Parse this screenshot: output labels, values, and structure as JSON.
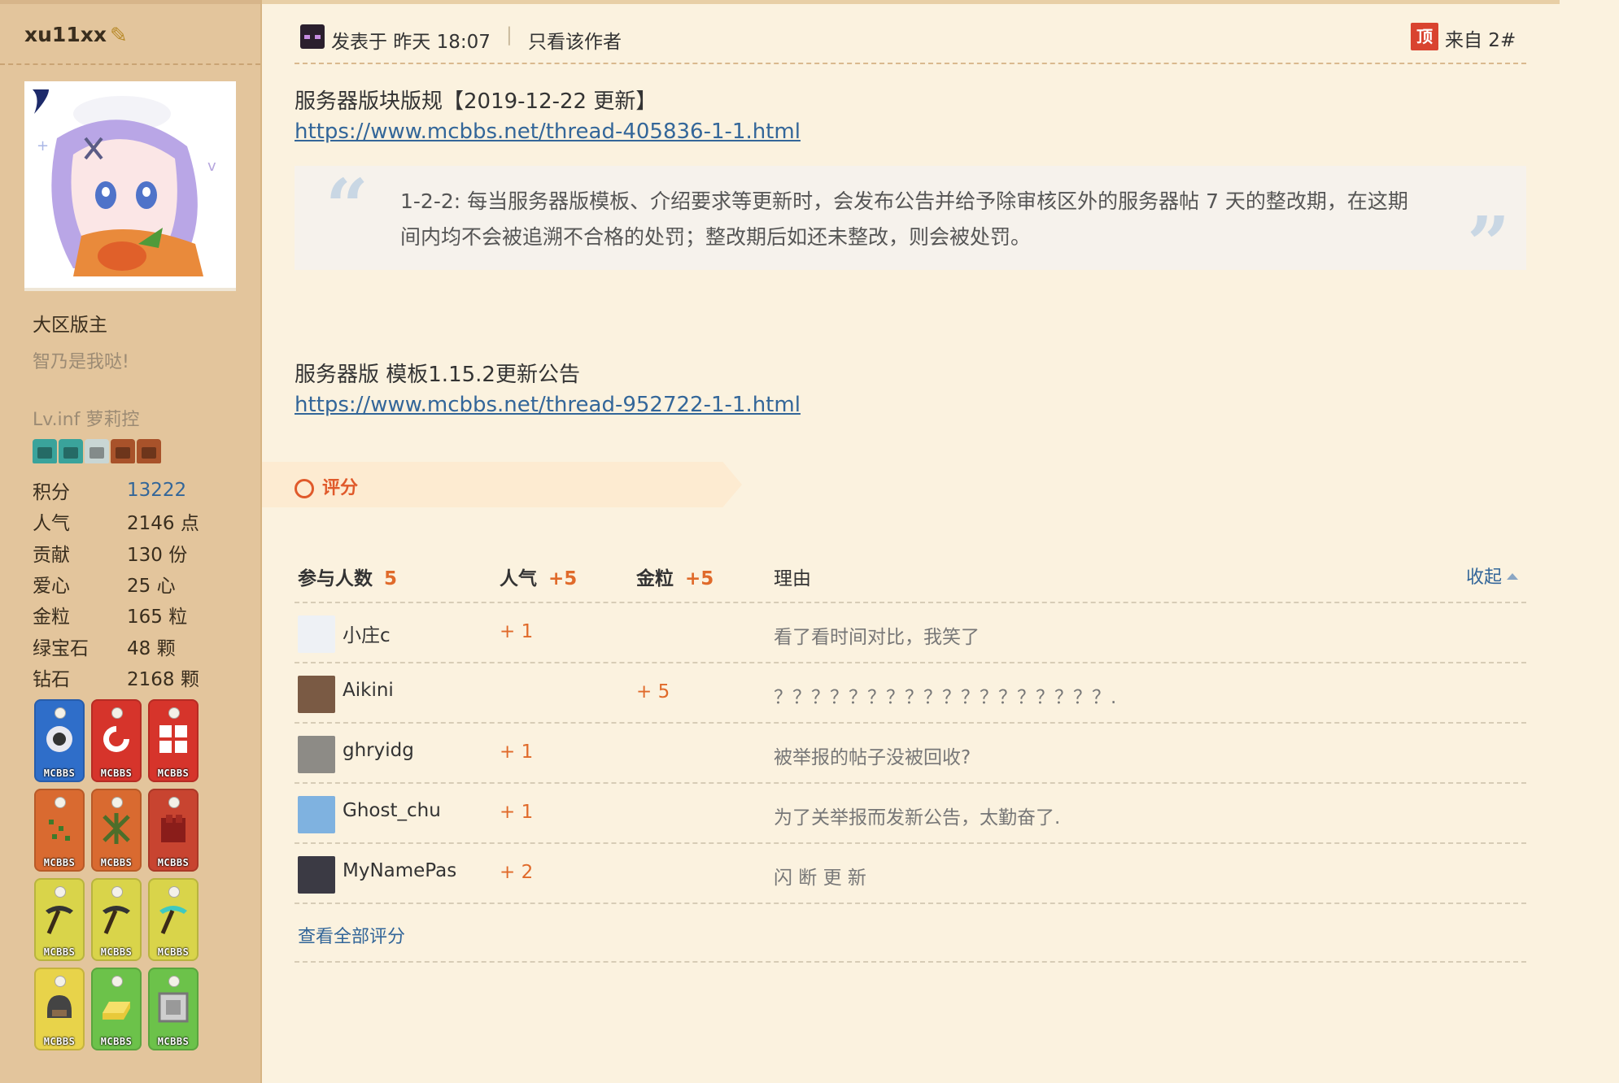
{
  "sidebar": {
    "username": "xu11xx",
    "role": "大区版主",
    "custom_title": "智乃是我哒!",
    "level": "Lv.inf 萝莉控",
    "level_colors": [
      "#3aa39b",
      "#3aa39b",
      "#c9d6d4",
      "#a8522a",
      "#a8522a"
    ],
    "stats": [
      {
        "key": "积分",
        "value": "13222",
        "link": true
      },
      {
        "key": "人气",
        "value": "2146 点",
        "link": false
      },
      {
        "key": "贡献",
        "value": "130 份",
        "link": false
      },
      {
        "key": "爱心",
        "value": "25 心",
        "link": false
      },
      {
        "key": "金粒",
        "value": "165 粒",
        "link": false
      },
      {
        "key": "绿宝石",
        "value": "48 颗",
        "link": false
      },
      {
        "key": "钻石",
        "value": "2168 颗",
        "link": false
      }
    ],
    "medals": [
      {
        "color": "#2f6ec9",
        "icon": "eye-icon",
        "tag": "MCBBS"
      },
      {
        "color": "#d6342b",
        "icon": "swirl-icon",
        "tag": "MCBBS"
      },
      {
        "color": "#d6342b",
        "icon": "window-icon",
        "tag": "MCBBS"
      },
      {
        "color": "#d96a30",
        "icon": "seeds-icon",
        "tag": "MCBBS"
      },
      {
        "color": "#d96a30",
        "icon": "vine-icon",
        "tag": "MCBBS"
      },
      {
        "color": "#c84430",
        "icon": "netherwart-icon",
        "tag": "MCBBS"
      },
      {
        "color": "#d9d44a",
        "icon": "pickaxe-icon",
        "tag": "MCBBS"
      },
      {
        "color": "#d9d44a",
        "icon": "pickaxe-icon",
        "tag": "MCBBS"
      },
      {
        "color": "#d9d44a",
        "icon": "diamond-pickaxe-icon",
        "tag": "MCBBS"
      },
      {
        "color": "#e8d34a",
        "icon": "helmet-icon",
        "tag": "MCBBS"
      },
      {
        "color": "#6cc24a",
        "icon": "gold-ingot-icon",
        "tag": "MCBBS"
      },
      {
        "color": "#6cc24a",
        "icon": "frame-icon",
        "tag": "MCBBS"
      }
    ]
  },
  "post": {
    "posted_at": "发表于 昨天 18:07",
    "separator": "|",
    "only_author": "只看该作者",
    "top_badge": "顶",
    "floor": "来自 2#",
    "line1": "服务器版块版规【2019-12-22 更新】",
    "link1": "https://www.mcbbs.net/thread-405836-1-1.html",
    "quote": "1-2-2: 每当服务器版模板、介绍要求等更新时，会发布公告并给予除审核区外的服务器帖 7 天的整改期，在这期间内均不会被追溯不合格的处罚；整改期后如还未整改，则会被处罚。",
    "line2": "服务器版 模板1.15.2更新公告",
    "link2": "https://www.mcbbs.net/thread-952722-1-1.html"
  },
  "rating": {
    "tab_label": "评分",
    "headers": {
      "participants": "参与人数",
      "participants_count": "5",
      "popularity": "人气",
      "popularity_total": "+5",
      "gold": "金粒",
      "gold_total": "+5",
      "reason": "理由",
      "collapse": "收起"
    },
    "rows": [
      {
        "name": "小庄c",
        "popularity": "+ 1",
        "gold": "",
        "reason": "看了看时间对比，我笑了",
        "avatar_color": "#eef1f5"
      },
      {
        "name": "Aikini",
        "popularity": "",
        "gold": "+ 5",
        "reason": "？？？？？？？？？？？？？？？？？？.",
        "avatar_color": "#7a5a44"
      },
      {
        "name": "ghryidg",
        "popularity": "+ 1",
        "gold": "",
        "reason": "被举报的帖子没被回收?",
        "avatar_color": "#8d8b86"
      },
      {
        "name": "Ghost_chu",
        "popularity": "+ 1",
        "gold": "",
        "reason": "为了关举报而发新公告，太勤奋了.",
        "avatar_color": "#7fb2e0"
      },
      {
        "name": "MyNamePas",
        "popularity": "+ 2",
        "gold": "",
        "reason": "闪 断 更 新",
        "avatar_color": "#3b3a44"
      }
    ],
    "view_all": "查看全部评分"
  }
}
